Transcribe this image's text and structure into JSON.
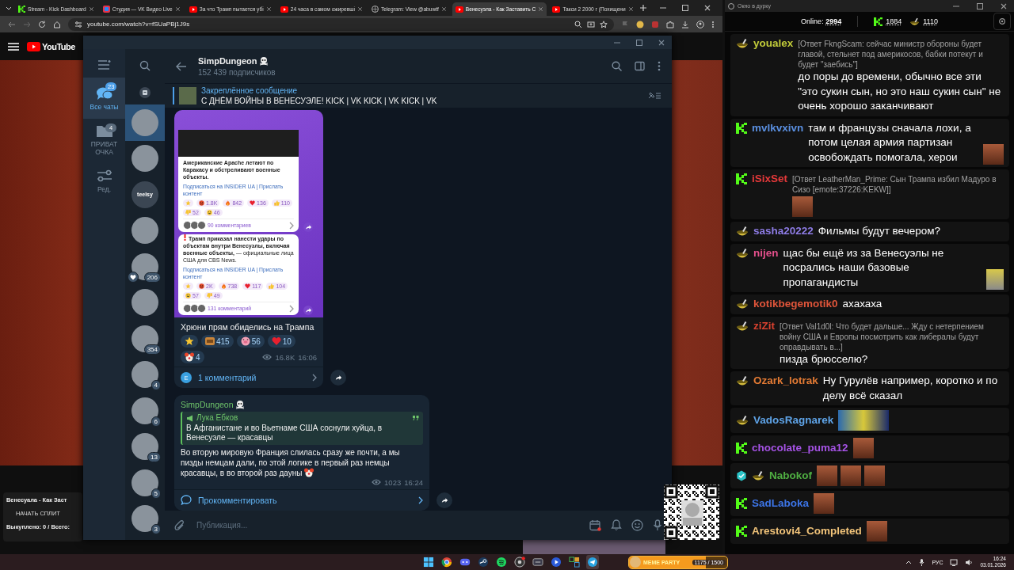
{
  "browser": {
    "tabs": [
      {
        "title": "Stream - Kick Dashboard",
        "kind": "kick",
        "selected": false
      },
      {
        "title": "Студия — VK Видео Live",
        "kind": "vk",
        "selected": false
      },
      {
        "title": "За что Трамп пытается убі",
        "kind": "youtube",
        "selected": false
      },
      {
        "title": "24 часа в самом ожиревші",
        "kind": "youtube",
        "selected": false
      },
      {
        "title": "Telegram: View @abuwtf",
        "kind": "web",
        "selected": false
      },
      {
        "title": "Венесуэла - Как Заставить С",
        "kind": "youtube",
        "selected": true
      },
      {
        "title": "Такси 2 2000 г (Похищени",
        "kind": "youtube",
        "selected": false
      }
    ],
    "address": "youtube.com/watch?v=fSUaPBj1J9s"
  },
  "youtube": {
    "logo": "YouTube",
    "panel": {
      "title": "Венесуала - Как Заст",
      "button": "НАЧАТЬ СПЛИТ",
      "status": "Выкуплено: 0 / Всего:"
    }
  },
  "telegram": {
    "folders": [
      {
        "kind": "chats",
        "label": "Все чаты",
        "badge": "23",
        "selected": true
      },
      {
        "kind": "folder",
        "label": "ПРИВАТ ОЧКА",
        "badge": "4",
        "selected": false
      },
      {
        "kind": "edit",
        "label": "Ред.",
        "selected": false
      }
    ],
    "chats": [
      {
        "kind": "photo",
        "selected": true,
        "reaction": false
      },
      {
        "kind": "photo",
        "selected": false,
        "reaction": false
      },
      {
        "kind": "text",
        "avatar_text": "teelsy",
        "selected": false,
        "reaction": false
      },
      {
        "kind": "photo",
        "selected": false,
        "reaction": false
      },
      {
        "kind": "photo",
        "badge": "206",
        "selected": false,
        "reaction": true
      },
      {
        "kind": "photo",
        "selected": false,
        "reaction": false
      },
      {
        "kind": "photo",
        "badge": "354",
        "selected": false,
        "reaction": false
      },
      {
        "kind": "photo",
        "badge": "4",
        "selected": false,
        "reaction": false
      },
      {
        "kind": "photo",
        "badge": "6",
        "selected": false,
        "reaction": false
      },
      {
        "kind": "photo",
        "badge": "13",
        "selected": false,
        "reaction": false
      },
      {
        "kind": "photo",
        "badge": "5",
        "selected": false,
        "reaction": false
      },
      {
        "kind": "photo",
        "badge": "3",
        "selected": false,
        "reaction": false
      }
    ],
    "channel": {
      "name": "SimpDungeon",
      "subscribers": "152 439 подписчиков"
    },
    "pinned": {
      "label": "Закреплённое сообщение",
      "text": "С ДНЁМ ВОЙНЫ В ВЕНЕСУЭЛЕ!  KICK | VK KICK | VK KICK | VK"
    },
    "posts": [
      {
        "kind": "media",
        "embedded": [
          {
            "text": "Американские Apache летают по Каракасу и обстреливают военные объекты.",
            "link": "Подписаться на INSIDER UA | Прислать контент",
            "reactions": [
              {
                "kind": "star"
              },
              {
                "kind": "angry",
                "count": "1.8K"
              },
              {
                "kind": "fire",
                "count": "842"
              },
              {
                "kind": "heart",
                "count": "136"
              },
              {
                "kind": "like",
                "count": "110"
              },
              {
                "kind": "dislike",
                "count": "52"
              },
              {
                "kind": "grin",
                "count": "46"
              }
            ],
            "comments": "90 комментариев"
          },
          {
            "text": "**Трамп приказал нанести удары по объектам внутри Венесуэлы, включая военные объекты,** — официальные лица США для CBS News.",
            "link": "Подписаться на INSIDER UA | Прислать контент",
            "reactions": [
              {
                "kind": "star"
              },
              {
                "kind": "angry",
                "count": "2K"
              },
              {
                "kind": "fire",
                "count": "738"
              },
              {
                "kind": "heart",
                "count": "117"
              },
              {
                "kind": "like",
                "count": "104"
              },
              {
                "kind": "grin",
                "count": "57"
              },
              {
                "kind": "dislike",
                "count": "49"
              }
            ],
            "comments": "131 комментарий"
          }
        ],
        "caption": "Хрюни прям обиделись на Трампа",
        "reactions": [
          {
            "kind": "star"
          },
          {
            "kind": "sticker",
            "count": "415"
          },
          {
            "kind": "pig",
            "count": "56"
          },
          {
            "kind": "heart",
            "count": "10"
          },
          {
            "kind": "clown",
            "count": "4"
          }
        ],
        "views": "16.8K",
        "time": "16:06",
        "comments": {
          "avatar": "E",
          "label": "1 комментарий"
        }
      },
      {
        "kind": "text",
        "author": "SimpDungeon",
        "quote": {
          "author": "Лука Ебков",
          "text": "В Афганистане и во Вьетнаме США соснули хуйца, в Венесуэле — красавцы"
        },
        "text": "Во вторую мировую Франция слилась сразу же почти, а мы пизды немцам дали, по этой логике в первый раз немцы красавцы, в во второй раз дауны",
        "views": "1023",
        "time": "16:24",
        "comment_action": "Прокомментировать"
      }
    ],
    "composer": {
      "placeholder": "Публикация..."
    }
  },
  "chat": {
    "title": "Окно в дурку",
    "online": "Online: **2994**",
    "platforms": [
      {
        "kind": "kick",
        "count": "1884"
      },
      {
        "kind": "vk",
        "count": "1110"
      }
    ],
    "messages": [
      {
        "kind": "vk",
        "user": "youalex",
        "color": "#c2cc3a",
        "verified": false,
        "reply": "[Ответ FkngScam: сейчас министр обороны будет главой, стельнет под америкосов, бабки потекут и будет \"заебись\"]",
        "text": "до поры до времени, обычно все эти \"это сукин сын, но это наш сукин сын\" не очень хорошо заканчивают"
      },
      {
        "kind": "kick",
        "user": "mvlkvxivn",
        "color": "#5a8fe0",
        "verified": false,
        "text": "там и французы сначала лохи, а потом целая армия партизан освобождать помогала, херои",
        "emotes": [
          {
            "kind": "face"
          }
        ]
      },
      {
        "kind": "kick",
        "user": "iSixSet",
        "color": "#e5393a",
        "verified": false,
        "reply": "[Ответ LeatherMan_Prime: Сын Трампа избил Мадуро в Сизо [emote:37226:KEKW]]",
        "emotes": [
          {
            "kind": "face"
          }
        ]
      },
      {
        "kind": "vk",
        "user": "sasha20222",
        "color": "#8e7ce6",
        "verified": false,
        "text": "Фильмы будут вечером?"
      },
      {
        "kind": "vk",
        "user": "nijen",
        "color": "#e4508c",
        "verified": false,
        "text": "щас бы ещё из за Венесуэлы не посрались наши базовые пропагандисты",
        "emotes": [
          {
            "kind": "cartoon"
          }
        ]
      },
      {
        "kind": "vk",
        "user": "kotikbegemotik0",
        "color": "#e0553a",
        "verified": false,
        "text": "ахахаха"
      },
      {
        "kind": "vk",
        "user": "ziZit",
        "color": "#d9412f",
        "verified": false,
        "reply": "[Ответ Val1d0l: Что будет дальше... Жду с нетерпением войну США и Европы посмотрить как либералы будут оправдывать в...]",
        "text": "пизда брюсселю?"
      },
      {
        "kind": "vk",
        "user": "Ozark_lotrak",
        "color": "#e27a34",
        "verified": false,
        "text": "Ну Гурулёв например, коротко и по делу всё сказал"
      },
      {
        "kind": "vk",
        "user": "VadosRagnarek",
        "color": "#5fa4e8",
        "verified": false,
        "emotes": [
          {
            "kind": "scene"
          }
        ]
      },
      {
        "kind": "kick",
        "user": "chocolate_puma12",
        "color": "#a653e6",
        "verified": false,
        "emotes": [
          {
            "kind": "face"
          }
        ]
      },
      {
        "kind": "vk",
        "user": "Nabokof",
        "color": "#4fae42",
        "verified": true,
        "emotes": [
          {
            "kind": "face"
          },
          {
            "kind": "face"
          },
          {
            "kind": "face"
          }
        ]
      },
      {
        "kind": "kick",
        "user": "SadLaboka",
        "color": "#3c74e6",
        "verified": false,
        "emotes": [
          {
            "kind": "face"
          }
        ]
      },
      {
        "kind": "kick",
        "user": "Arestovi4_Completed",
        "color": "#f2c47a",
        "verified": false,
        "emotes": [
          {
            "kind": "face"
          }
        ]
      }
    ]
  },
  "taskbar": {
    "apps": [
      {
        "kind": "start",
        "selected": false
      },
      {
        "kind": "browser",
        "selected": false
      },
      {
        "kind": "chat",
        "selected": false
      },
      {
        "kind": "steam",
        "selected": false
      },
      {
        "kind": "music",
        "selected": false
      },
      {
        "kind": "record",
        "selected": false
      },
      {
        "kind": "media",
        "selected": false
      },
      {
        "kind": "player",
        "selected": false
      },
      {
        "kind": "snip",
        "selected": false
      },
      {
        "kind": "telegram",
        "selected": true
      }
    ],
    "widget": {
      "title": "MEME PARTY",
      "progress": "1175 / 1500",
      "level": 0.78
    },
    "tray": {
      "language": "РУС",
      "time": "16:24",
      "date": "03.01.2026"
    }
  }
}
